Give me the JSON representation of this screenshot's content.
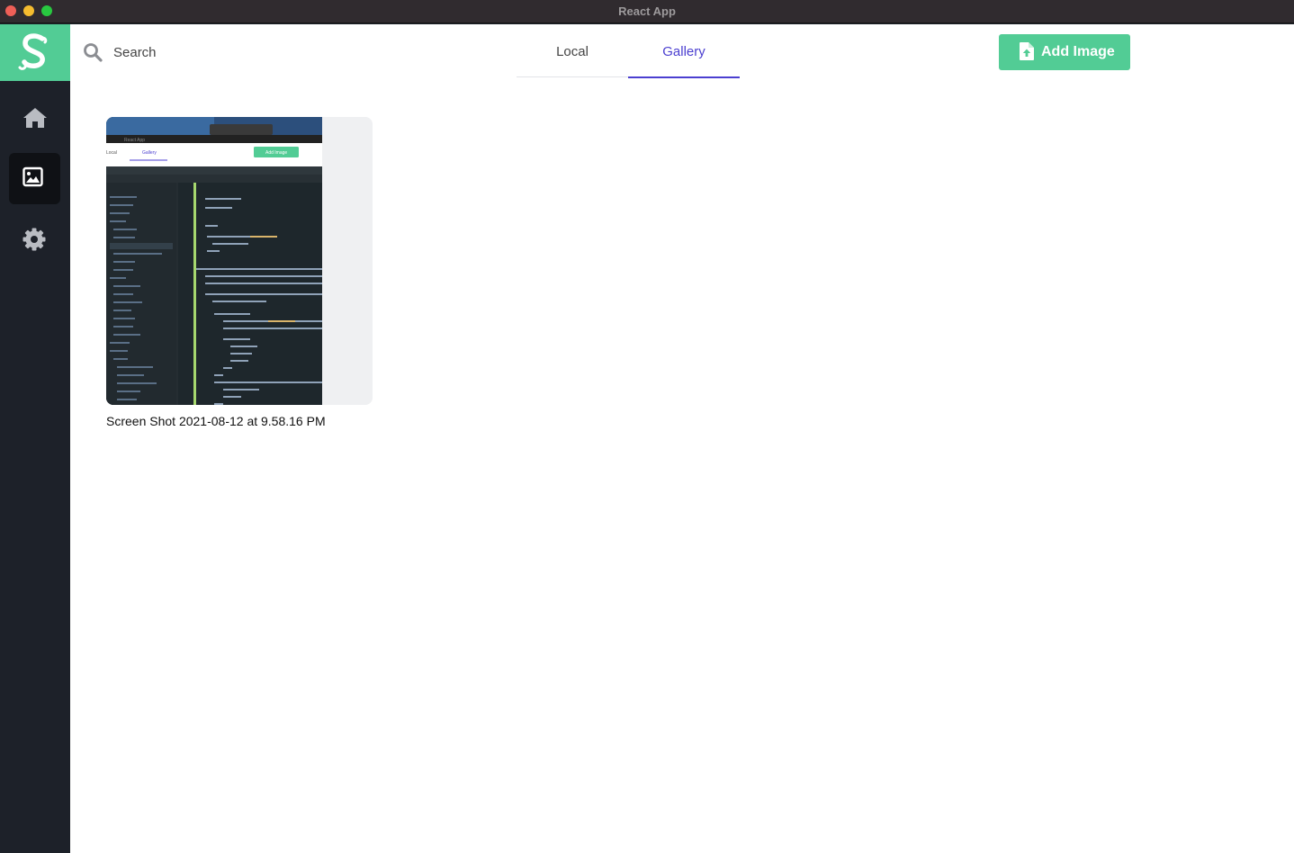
{
  "window": {
    "title": "React App"
  },
  "sidebar": {
    "items": [
      {
        "name": "home",
        "icon": "home-icon",
        "active": false
      },
      {
        "name": "gallery",
        "icon": "image-icon",
        "active": true
      },
      {
        "name": "settings",
        "icon": "gear-icon",
        "active": false
      }
    ]
  },
  "search": {
    "placeholder": "Search",
    "value": ""
  },
  "tabs": [
    {
      "label": "Local",
      "active": false
    },
    {
      "label": "Gallery",
      "active": true
    }
  ],
  "toolbar": {
    "add_label": "Add Image"
  },
  "gallery": {
    "items": [
      {
        "caption": "Screen Shot 2021-08-12 at 9.58.16 PM",
        "thumbnail": {
          "app_title": "React App",
          "tab_local": "Local",
          "tab_gallery": "Gallery",
          "add_label": "Add Image"
        }
      }
    ]
  },
  "colors": {
    "accent": "#52cc95",
    "tab_active": "#4b3fd0",
    "sidebar": "#1d2129"
  }
}
